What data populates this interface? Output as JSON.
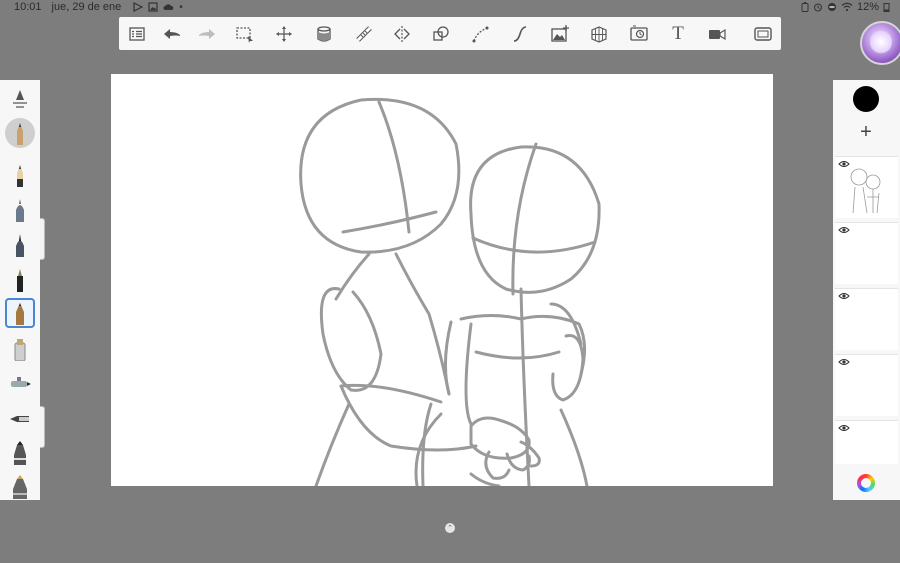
{
  "status_bar": {
    "time": "10:01",
    "date": "jue, 29 de ene",
    "notification_icons": [
      "play-store-icon",
      "gallery-icon",
      "cloud-icon"
    ],
    "notification_dot": "•",
    "battery": "12%",
    "status_icons": [
      "battery-saver-icon",
      "alarm-icon",
      "do-not-disturb-icon",
      "wifi-icon"
    ]
  },
  "toolbar": {
    "tools": [
      {
        "name": "layers-list-icon"
      },
      {
        "name": "undo-icon"
      },
      {
        "name": "redo-icon"
      },
      {
        "name": "selection-icon"
      },
      {
        "name": "transform-icon"
      },
      {
        "name": "fill-icon"
      },
      {
        "name": "ruler-icon"
      },
      {
        "name": "symmetry-icon"
      },
      {
        "name": "shape-icon"
      },
      {
        "name": "perspective-curve-icon"
      },
      {
        "name": "stroke-curve-icon"
      },
      {
        "name": "image-import-icon"
      },
      {
        "name": "perspective-grid-icon"
      },
      {
        "name": "time-lapse-icon"
      },
      {
        "name": "text-icon",
        "glyph": "T"
      },
      {
        "name": "video-record-icon"
      },
      {
        "name": "fullscreen-icon"
      }
    ]
  },
  "brushes": {
    "items": [
      "brush-size-slider",
      "pencil-round",
      "pencil-hb",
      "ballpoint-pen",
      "ink-pen",
      "fine-marker",
      "pencil-selected",
      "marker-chisel",
      "airbrush",
      "paint-brush",
      "flat-brush",
      "wide-brush"
    ],
    "selected_index": 6
  },
  "layers": {
    "current_color": "#000000",
    "add_label": "+",
    "count": 5,
    "visible": [
      true,
      true,
      true,
      true,
      true
    ]
  },
  "bottom": {
    "expand_glyph": "⌃"
  },
  "colors": {
    "panel": "#f7f7f7",
    "background": "#7d7d7d",
    "selected_accent": "#4a86d6",
    "sketch_stroke": "#9a9a9a"
  }
}
